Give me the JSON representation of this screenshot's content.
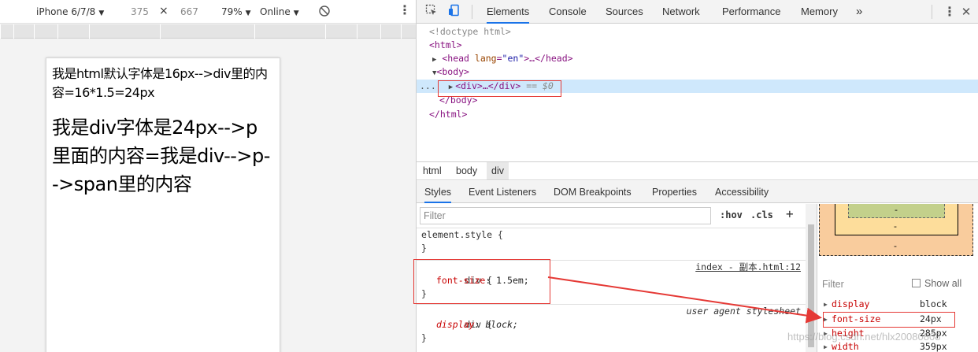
{
  "device_toolbar": {
    "device": "iPhone 6/7/8",
    "width": "375",
    "times": "×",
    "height": "667",
    "zoom": "79%",
    "network": "Online"
  },
  "viewport": {
    "html_text": "我是html默认字体是16px-->div里的内容=16*1.5=24px",
    "div_text": "我是div字体是24px-->p里面的内容=我是div-->p-->span里的内容"
  },
  "devtools": {
    "tabs": [
      "Elements",
      "Console",
      "Sources",
      "Network",
      "Performance",
      "Memory"
    ],
    "more": "»",
    "active_tab": "Elements",
    "dom": {
      "doctype": "<!doctype html>",
      "html_open": "<html>",
      "head_open": "<head ",
      "head_attr": "lang",
      "head_val": "\"en\"",
      "head_rest": ">…</head>",
      "body_open": "<body>",
      "div_row": "<div>…</div>",
      "div_eq": "== $0",
      "body_close": "</body>",
      "html_close": "</html>",
      "ellipsis": "..."
    },
    "breadcrumb": [
      "html",
      "body",
      "div"
    ],
    "sub_tabs": [
      "Styles",
      "Event Listeners",
      "DOM Breakpoints",
      "Properties",
      "Accessibility"
    ],
    "styles": {
      "filter_placeholder": "Filter",
      "hov": ":hov",
      "cls": ".cls",
      "plus": "+",
      "rules": [
        {
          "selector": "element.style {",
          "close": "}"
        },
        {
          "selector": "div {",
          "prop": "font-size",
          "value": "1.5em;",
          "source": "index - 副本.html:12",
          "close": "}"
        },
        {
          "selector": "div {",
          "prop": "display",
          "value": "block;",
          "source": "user agent stylesheet",
          "close": "}"
        }
      ]
    },
    "computed": {
      "filter": "Filter",
      "show_all": "Show all",
      "box_dash": "-",
      "props": [
        {
          "name": "display",
          "value": "block"
        },
        {
          "name": "font-size",
          "value": "24px"
        },
        {
          "name": "height",
          "value": "285px"
        },
        {
          "name": "width",
          "value": "359px"
        }
      ]
    }
  },
  "watermark": "https://blog.csdn.net/hlx20080808",
  "colors": {
    "highlight": "#e53935",
    "accent": "#1a73e8",
    "selected_row": "#cfe8fc"
  }
}
